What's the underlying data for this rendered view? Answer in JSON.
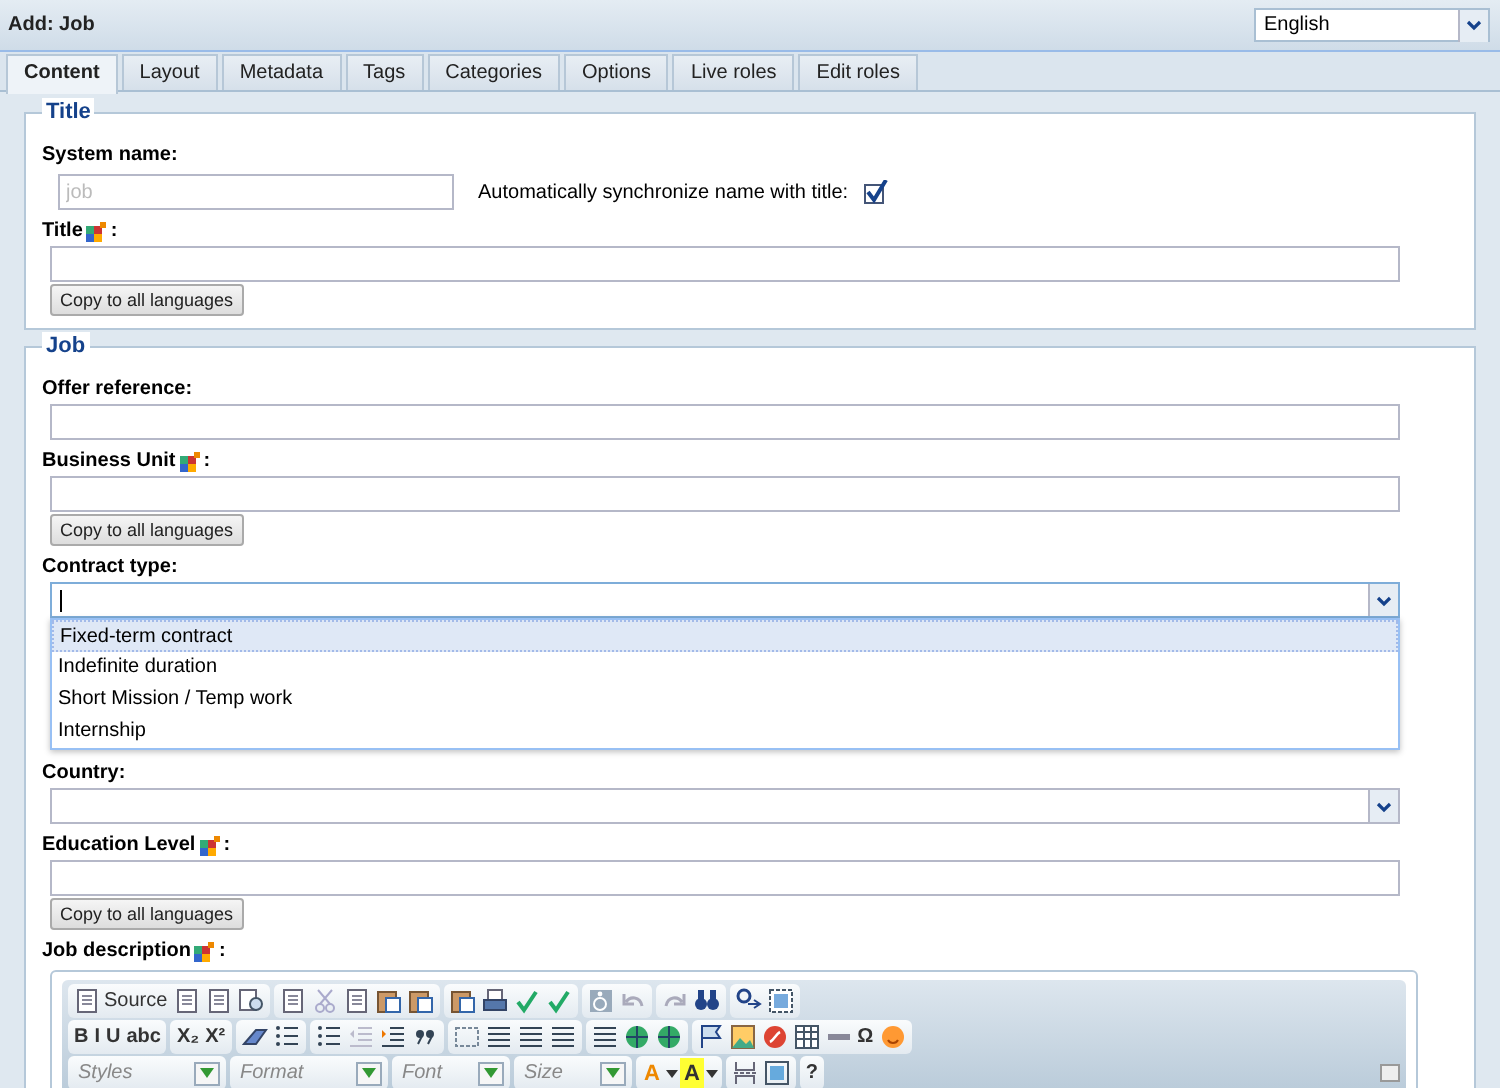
{
  "header": {
    "title": "Add: Job",
    "language": "English"
  },
  "tabs": [
    {
      "label": "Content",
      "selected": true
    },
    {
      "label": "Layout",
      "selected": false
    },
    {
      "label": "Metadata",
      "selected": false
    },
    {
      "label": "Tags",
      "selected": false
    },
    {
      "label": "Categories",
      "selected": false
    },
    {
      "label": "Options",
      "selected": false
    },
    {
      "label": "Live roles",
      "selected": false
    },
    {
      "label": "Edit roles",
      "selected": false
    }
  ],
  "sections": [
    {
      "legend": "Title",
      "fields": [
        {
          "kind": "system_name",
          "label": "System name:",
          "placeholder": "job",
          "sync_label": "Automatically synchronize name with title:",
          "sync_checked": true
        },
        {
          "kind": "text",
          "label": "Title",
          "multilingual": true,
          "suffix": ":",
          "copy_button": "Copy to all languages"
        }
      ]
    },
    {
      "legend": "Job",
      "fields": [
        {
          "kind": "text",
          "label": "Offer reference:",
          "multilingual": false
        },
        {
          "kind": "text",
          "label": "Business Unit",
          "multilingual": true,
          "suffix": ":",
          "copy_button": "Copy to all languages"
        },
        {
          "kind": "combo",
          "label": "Contract type:",
          "expanded": true,
          "options": [
            {
              "label": "Fixed-term contract",
              "selected": true
            },
            {
              "label": "Indefinite duration",
              "selected": false
            },
            {
              "label": "Short Mission / Temp work",
              "selected": false
            },
            {
              "label": "Internship",
              "selected": false
            }
          ]
        },
        {
          "kind": "combo",
          "label": "Country:",
          "expanded": false
        },
        {
          "kind": "text",
          "label": "Education Level",
          "multilingual": true,
          "suffix": ":",
          "copy_button": "Copy to all languages"
        },
        {
          "kind": "editor",
          "label": "Job description",
          "multilingual": true,
          "suffix": ":",
          "toolbar": [
            [
              [
                {
                  "kind": "text",
                  "label": "Source"
                },
                {
                  "kind": "icon"
                },
                {
                  "kind": "icon"
                },
                {
                  "kind": "icon"
                }
              ],
              [
                {
                  "kind": "icon"
                },
                {
                  "kind": "icon"
                },
                {
                  "kind": "icon"
                },
                {
                  "kind": "icon"
                },
                {
                  "kind": "icon"
                }
              ],
              [
                {
                  "kind": "icon"
                },
                {
                  "kind": "icon"
                },
                {
                  "kind": "icon"
                },
                {
                  "kind": "icon"
                }
              ],
              [
                {
                  "kind": "icon"
                },
                {
                  "kind": "icon"
                }
              ],
              [
                {
                  "kind": "icon"
                },
                {
                  "kind": "icon"
                }
              ],
              [
                {
                  "kind": "icon"
                },
                {
                  "kind": "icon"
                }
              ]
            ],
            [
              [
                {
                  "kind": "text",
                  "label": "B"
                },
                {
                  "kind": "text",
                  "label": "I"
                },
                {
                  "kind": "text",
                  "label": "U"
                },
                {
                  "kind": "text",
                  "label": "abc"
                }
              ],
              [
                {
                  "kind": "text",
                  "label": "X₂"
                },
                {
                  "kind": "text",
                  "label": "X²"
                }
              ],
              [
                {
                  "kind": "icon"
                },
                {
                  "kind": "icon"
                }
              ],
              [
                {
                  "kind": "icon"
                },
                {
                  "kind": "icon"
                },
                {
                  "kind": "icon"
                },
                {
                  "kind": "icon"
                }
              ],
              [
                {
                  "kind": "icon"
                },
                {
                  "kind": "icon"
                },
                {
                  "kind": "icon"
                },
                {
                  "kind": "icon"
                }
              ],
              [
                {
                  "kind": "icon"
                },
                {
                  "kind": "icon"
                },
                {
                  "kind": "icon"
                }
              ],
              [
                {
                  "kind": "icon"
                },
                {
                  "kind": "icon"
                },
                {
                  "kind": "icon"
                },
                {
                  "kind": "icon"
                },
                {
                  "kind": "icon"
                },
                {
                  "kind": "text",
                  "label": "Ω"
                },
                {
                  "kind": "icon"
                }
              ]
            ],
            [
              [
                {
                  "kind": "combo",
                  "label": "Styles"
                }
              ],
              [
                {
                  "kind": "combo",
                  "label": "Format"
                }
              ],
              [
                {
                  "kind": "combo",
                  "label": "Font"
                }
              ],
              [
                {
                  "kind": "combo",
                  "label": "Size"
                }
              ],
              [
                {
                  "kind": "color",
                  "label": "A"
                },
                {
                  "kind": "color",
                  "label": "A"
                }
              ],
              [
                {
                  "kind": "icon"
                },
                {
                  "kind": "icon"
                }
              ],
              [
                {
                  "kind": "text",
                  "label": "?"
                }
              ]
            ]
          ]
        }
      ]
    }
  ]
}
